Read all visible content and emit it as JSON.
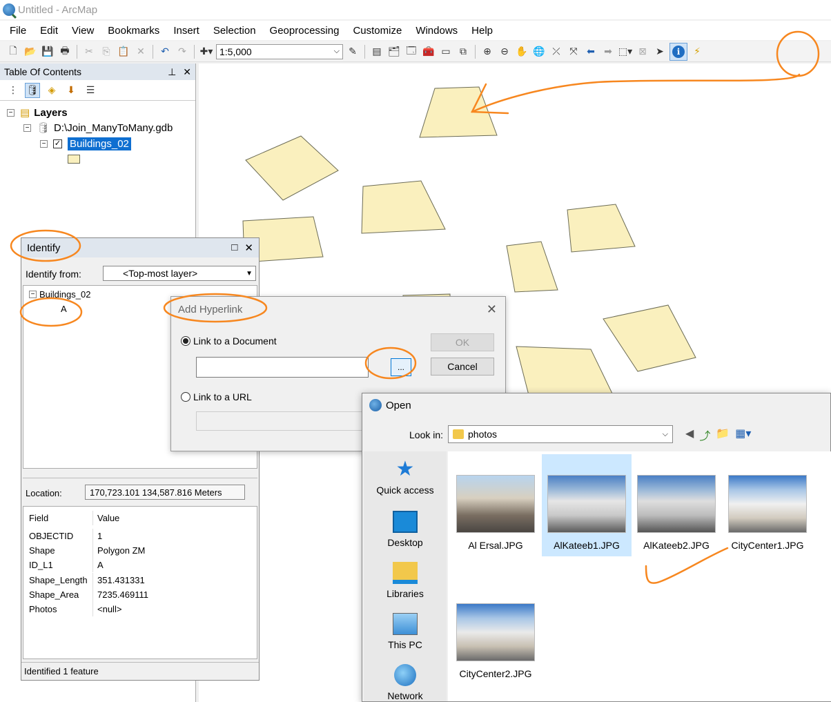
{
  "window": {
    "title": "Untitled - ArcMap"
  },
  "menu": [
    "File",
    "Edit",
    "View",
    "Bookmarks",
    "Insert",
    "Selection",
    "Geoprocessing",
    "Customize",
    "Windows",
    "Help"
  ],
  "toolbar": {
    "scale": "1:5,000"
  },
  "toc": {
    "title": "Table Of Contents",
    "pin": "⊥",
    "close": "✕",
    "layers_label": "Layers",
    "database": "D:\\Join_ManyToMany.gdb",
    "layer": "Buildings_02"
  },
  "identify": {
    "title": "Identify",
    "identify_from_label": "Identify from:",
    "identify_from_value": "<Top-most layer>",
    "tree_layer": "Buildings_02",
    "tree_feature": "A",
    "location_label": "Location:",
    "location_value": "170,723.101  134,587.816 Meters",
    "field_header": "Field",
    "value_header": "Value",
    "fields": [
      {
        "field": "OBJECTID",
        "value": "1"
      },
      {
        "field": "Shape",
        "value": "Polygon ZM"
      },
      {
        "field": "ID_L1",
        "value": "A"
      },
      {
        "field": "Shape_Length",
        "value": "351.431331"
      },
      {
        "field": "Shape_Area",
        "value": "7235.469111"
      },
      {
        "field": "Photos",
        "value": "<null>"
      }
    ],
    "status": "Identified 1 feature"
  },
  "hyperlink": {
    "title": "Add Hyperlink",
    "document_option": "Link to a Document",
    "url_option": "Link to a URL",
    "browse_label": "...",
    "ok_label": "OK",
    "cancel_label": "Cancel"
  },
  "open_dialog": {
    "title": "Open",
    "look_in_label": "Look in:",
    "look_in_value": "photos",
    "places": [
      "Quick access",
      "Desktop",
      "Libraries",
      "This PC",
      "Network"
    ],
    "files": [
      "Al Ersal.JPG",
      "AlKateeb1.JPG",
      "AlKateeb2.JPG",
      "CityCenter1.JPG",
      "CityCenter2.JPG"
    ],
    "selected_file": "AlKateeb1.JPG"
  },
  "colors": {
    "polygon_fill": "#faf0be",
    "polygon_stroke": "#6b6b55",
    "annotation": "#f7871f",
    "selection": "#0f6fd1"
  }
}
